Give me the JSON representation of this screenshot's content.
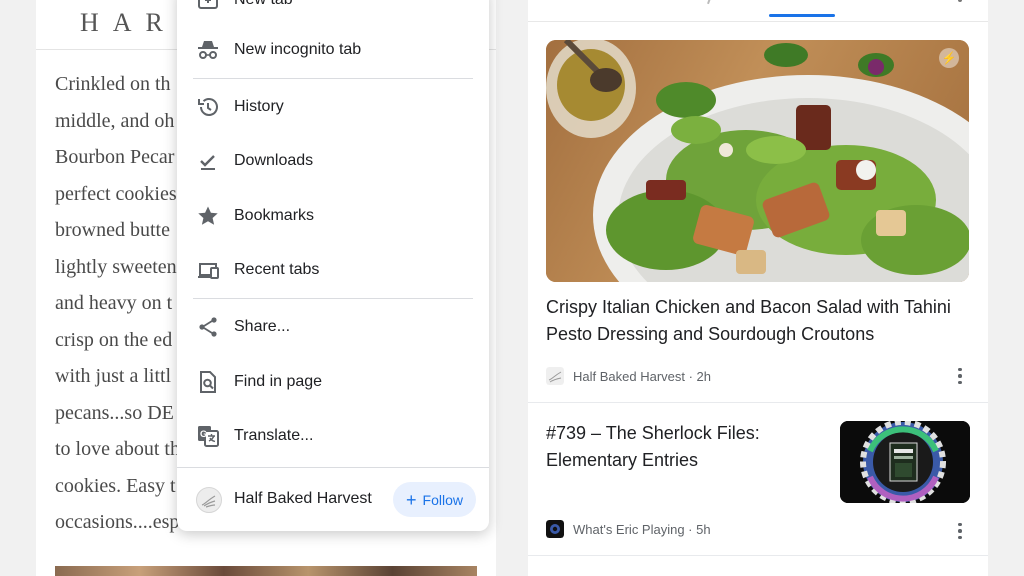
{
  "article": {
    "logo": "HAR",
    "lines": [
      "Crinkled on th",
      "middle, and oh",
      "Bourbon Pecar",
      "perfect cookies",
      "browned butte",
      "lightly sweeten",
      "and heavy on t",
      "crisp on the ed",
      "with just a littl",
      "pecans...so DE",
      "to love about th",
      "cookies. Easy t",
      "occasions....esp"
    ]
  },
  "menu": {
    "items": [
      {
        "label": "New tab",
        "icon": "new-tab-icon"
      },
      {
        "label": "New incognito tab",
        "icon": "incognito-icon"
      },
      {
        "label": "History",
        "icon": "history-icon"
      },
      {
        "label": "Downloads",
        "icon": "download-icon"
      },
      {
        "label": "Bookmarks",
        "icon": "star-icon"
      },
      {
        "label": "Recent tabs",
        "icon": "devices-icon"
      },
      {
        "label": "Share...",
        "icon": "share-icon"
      },
      {
        "label": "Find in page",
        "icon": "find-in-page-icon"
      },
      {
        "label": "Translate...",
        "icon": "translate-icon"
      }
    ],
    "site": {
      "name": "Half Baked Harvest",
      "follow_label": "Follow",
      "favicon": "half-baked-harvest-logo"
    }
  },
  "feed": {
    "cards": [
      {
        "title": "Crispy Italian Chicken and Bacon Salad with Tahini Pesto Dressing and Sourdough Croutons",
        "source": "Half Baked Harvest",
        "age": "2h",
        "meta": "Half Baked Harvest · 2h"
      },
      {
        "title": "#739 – The Sherlock Files: Elementary Entries",
        "source": "What's Eric Playing",
        "age": "5h",
        "meta": "What's Eric Playing · 5h"
      }
    ]
  },
  "colors": {
    "accent": "#1a73e8",
    "follow_bg": "#e8f0fe",
    "text_primary": "#202124",
    "text_secondary": "#5f6368",
    "icon": "#5f6368"
  }
}
